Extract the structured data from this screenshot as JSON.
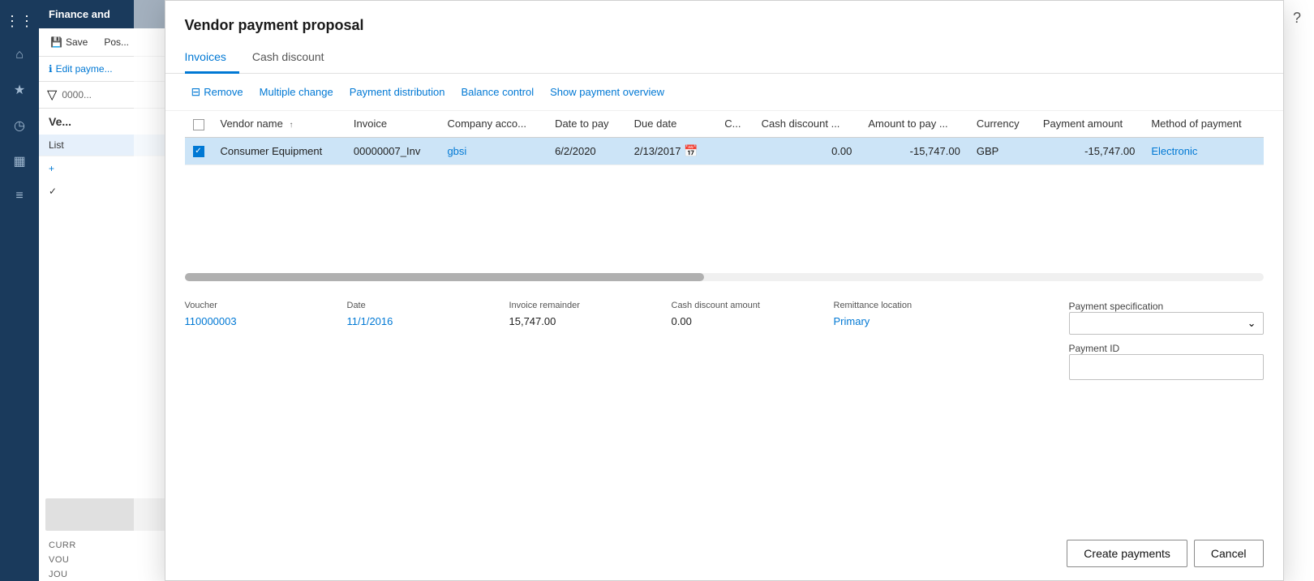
{
  "app": {
    "title": "Finance and",
    "help_icon": "?"
  },
  "sidebar": {
    "icons": [
      "grid",
      "home",
      "star",
      "recent",
      "chart",
      "list"
    ]
  },
  "panel": {
    "header": "Finance and",
    "save_label": "Save",
    "post_label": "Pos...",
    "edit_payment_label": "Edit payme...",
    "filter_icon": "filter",
    "record_id": "0000...",
    "title": "Ve...",
    "list_label": "List",
    "add_label": "+",
    "check_label": "",
    "cur_label": "CURR",
    "vol_label": "VOU",
    "jou_label": "JOU"
  },
  "dialog": {
    "title": "Vendor payment proposal",
    "tabs": [
      {
        "label": "Invoices",
        "active": true
      },
      {
        "label": "Cash discount",
        "active": false
      }
    ],
    "toolbar": {
      "remove_label": "Remove",
      "multiple_change_label": "Multiple change",
      "payment_distribution_label": "Payment distribution",
      "balance_control_label": "Balance control",
      "show_payment_overview_label": "Show payment overview"
    },
    "table": {
      "columns": [
        {
          "key": "check",
          "label": ""
        },
        {
          "key": "vendor_name",
          "label": "Vendor name",
          "sortable": true
        },
        {
          "key": "invoice",
          "label": "Invoice"
        },
        {
          "key": "company_acct",
          "label": "Company acco..."
        },
        {
          "key": "date_to_pay",
          "label": "Date to pay"
        },
        {
          "key": "due_date",
          "label": "Due date"
        },
        {
          "key": "c",
          "label": "C..."
        },
        {
          "key": "cash_discount",
          "label": "Cash discount ..."
        },
        {
          "key": "amount_to_pay",
          "label": "Amount to pay ..."
        },
        {
          "key": "currency",
          "label": "Currency"
        },
        {
          "key": "payment_amount",
          "label": "Payment amount"
        },
        {
          "key": "method_of_payment",
          "label": "Method of payment"
        }
      ],
      "rows": [
        {
          "check": "",
          "vendor_name": "Consumer Equipment",
          "invoice": "00000007_Inv",
          "company_acct": "gbsi",
          "date_to_pay": "6/2/2020",
          "due_date": "2/13/2017",
          "c": "",
          "cash_discount": "0.00",
          "amount_to_pay": "-15,747.00",
          "currency": "GBP",
          "payment_amount": "-15,747.00",
          "method_of_payment": "Electronic",
          "selected": true
        }
      ]
    },
    "detail": {
      "voucher_label": "Voucher",
      "voucher_value": "110000003",
      "date_label": "Date",
      "date_value": "11/1/2016",
      "invoice_remainder_label": "Invoice remainder",
      "invoice_remainder_value": "15,747.00",
      "cash_discount_amount_label": "Cash discount amount",
      "cash_discount_amount_value": "0.00",
      "remittance_location_label": "Remittance location",
      "remittance_location_value": "Primary",
      "payment_specification_label": "Payment specification",
      "payment_specification_value": "",
      "payment_id_label": "Payment ID",
      "payment_id_value": ""
    },
    "footer": {
      "create_payments_label": "Create payments",
      "cancel_label": "Cancel"
    }
  }
}
